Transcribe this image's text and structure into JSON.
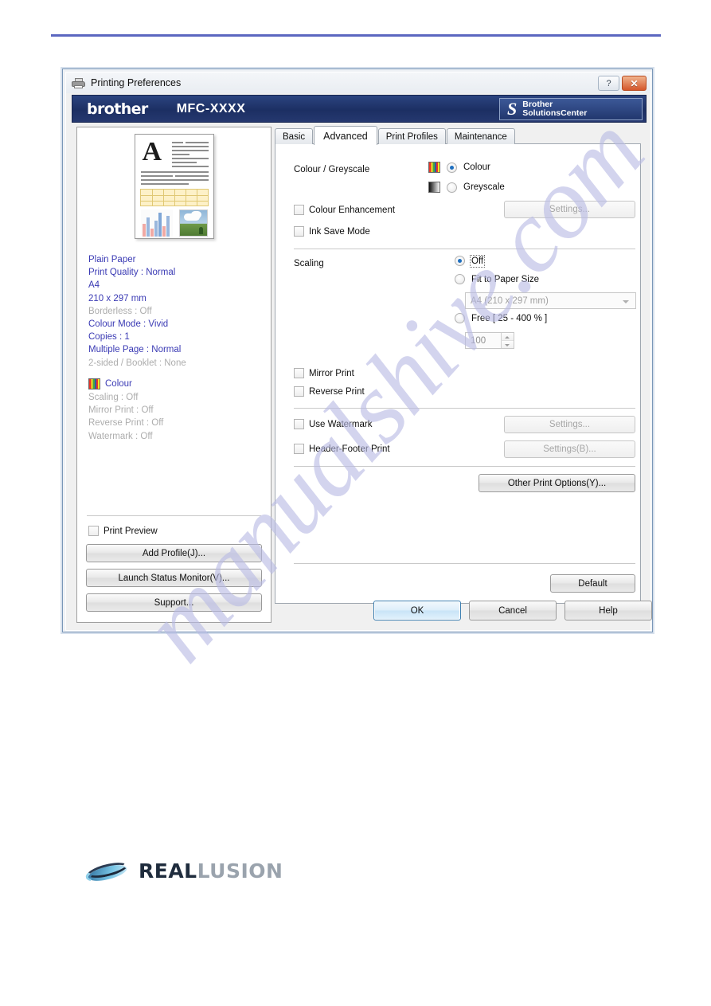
{
  "page": {
    "watermark_text": "manualshive.com",
    "rule_color": "#5b67c0"
  },
  "dialog": {
    "titlebar": {
      "title": "Printing Preferences",
      "icon": "printer-icon",
      "help_button": "?",
      "close_button": "✕"
    },
    "banner": {
      "brand": "brother",
      "model": "MFC-XXXX",
      "solutions_center": {
        "logo": "S",
        "line1": "Brother",
        "line2": "SolutionsCenter"
      }
    },
    "preview": {
      "summary": [
        {
          "text": "Plain Paper",
          "dim": false
        },
        {
          "text": "Print Quality : Normal",
          "dim": false
        },
        {
          "text": "A4",
          "dim": false
        },
        {
          "text": "210 x 297 mm",
          "dim": false
        },
        {
          "text": "Borderless : Off",
          "dim": true
        },
        {
          "text": "Colour Mode : Vivid",
          "dim": false
        },
        {
          "text": "Copies : 1",
          "dim": false
        },
        {
          "text": "Multiple Page : Normal",
          "dim": false
        },
        {
          "text": "2-sided / Booklet : None",
          "dim": true
        }
      ],
      "colour_label": "Colour",
      "summary2": [
        {
          "text": "Scaling : Off",
          "dim": true
        },
        {
          "text": "Mirror Print : Off",
          "dim": true
        },
        {
          "text": "Reverse Print : Off",
          "dim": true
        },
        {
          "text": "Watermark : Off",
          "dim": true
        }
      ],
      "print_preview_label": "Print Preview",
      "print_preview_checked": false,
      "buttons": {
        "add_profile": "Add Profile(J)...",
        "launch_status_monitor": "Launch Status Monitor(V)...",
        "support": "Support..."
      }
    },
    "tabs": [
      {
        "label": "Basic",
        "active": false
      },
      {
        "label": "Advanced",
        "active": true
      },
      {
        "label": "Print Profiles",
        "active": false
      },
      {
        "label": "Maintenance",
        "active": false
      }
    ],
    "advanced": {
      "colour_greyscale_label": "Colour / Greyscale",
      "colour_option": "Colour",
      "greyscale_option": "Greyscale",
      "colour_selected": true,
      "colour_enhancement_label": "Colour Enhancement",
      "colour_enhancement_checked": false,
      "colour_enhancement_settings": "Settings...",
      "ink_save_mode_label": "Ink Save Mode",
      "ink_save_mode_checked": false,
      "scaling_label": "Scaling",
      "scaling_off": "Off",
      "scaling_fit": "Fit to Paper Size",
      "scaling_free": "Free [ 25 - 400 % ]",
      "scaling_selected": "Off",
      "paper_size_value": "A4 (210 x 297 mm)",
      "free_value": "100",
      "mirror_print_label": "Mirror Print",
      "mirror_print_checked": false,
      "reverse_print_label": "Reverse Print",
      "reverse_print_checked": false,
      "use_watermark_label": "Use Watermark",
      "use_watermark_checked": false,
      "watermark_settings": "Settings...",
      "header_footer_label": "Header-Footer Print",
      "header_footer_checked": false,
      "header_footer_settings": "Settings(B)...",
      "other_print_options": "Other Print Options(Y)...",
      "default_button": "Default"
    },
    "footer": {
      "ok": "OK",
      "cancel": "Cancel",
      "help": "Help"
    }
  },
  "footer_logo": {
    "part1": "REAL",
    "part2": "LUSION"
  }
}
